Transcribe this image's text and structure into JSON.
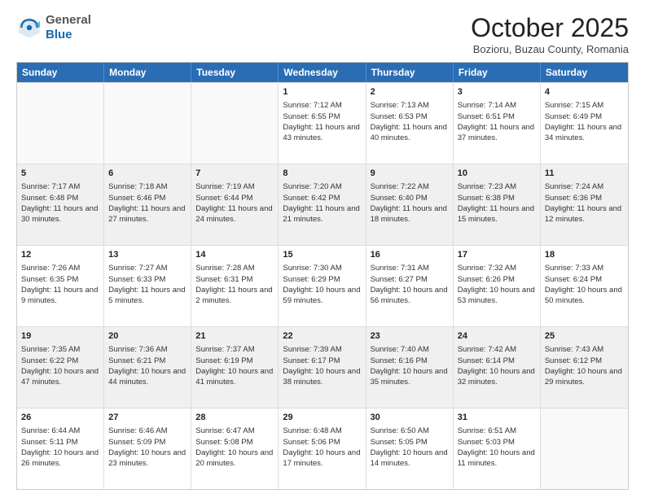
{
  "header": {
    "logo": {
      "general": "General",
      "blue": "Blue"
    },
    "title": "October 2025",
    "subtitle": "Bozioru, Buzau County, Romania"
  },
  "calendar": {
    "days_of_week": [
      "Sunday",
      "Monday",
      "Tuesday",
      "Wednesday",
      "Thursday",
      "Friday",
      "Saturday"
    ],
    "rows": [
      [
        {
          "day": "",
          "empty": true
        },
        {
          "day": "",
          "empty": true
        },
        {
          "day": "",
          "empty": true
        },
        {
          "day": "1",
          "sunrise": "7:12 AM",
          "sunset": "6:55 PM",
          "daylight": "11 hours and 43 minutes."
        },
        {
          "day": "2",
          "sunrise": "7:13 AM",
          "sunset": "6:53 PM",
          "daylight": "11 hours and 40 minutes."
        },
        {
          "day": "3",
          "sunrise": "7:14 AM",
          "sunset": "6:51 PM",
          "daylight": "11 hours and 37 minutes."
        },
        {
          "day": "4",
          "sunrise": "7:15 AM",
          "sunset": "6:49 PM",
          "daylight": "11 hours and 34 minutes."
        }
      ],
      [
        {
          "day": "5",
          "sunrise": "7:17 AM",
          "sunset": "6:48 PM",
          "daylight": "11 hours and 30 minutes."
        },
        {
          "day": "6",
          "sunrise": "7:18 AM",
          "sunset": "6:46 PM",
          "daylight": "11 hours and 27 minutes."
        },
        {
          "day": "7",
          "sunrise": "7:19 AM",
          "sunset": "6:44 PM",
          "daylight": "11 hours and 24 minutes."
        },
        {
          "day": "8",
          "sunrise": "7:20 AM",
          "sunset": "6:42 PM",
          "daylight": "11 hours and 21 minutes."
        },
        {
          "day": "9",
          "sunrise": "7:22 AM",
          "sunset": "6:40 PM",
          "daylight": "11 hours and 18 minutes."
        },
        {
          "day": "10",
          "sunrise": "7:23 AM",
          "sunset": "6:38 PM",
          "daylight": "11 hours and 15 minutes."
        },
        {
          "day": "11",
          "sunrise": "7:24 AM",
          "sunset": "6:36 PM",
          "daylight": "11 hours and 12 minutes."
        }
      ],
      [
        {
          "day": "12",
          "sunrise": "7:26 AM",
          "sunset": "6:35 PM",
          "daylight": "11 hours and 9 minutes."
        },
        {
          "day": "13",
          "sunrise": "7:27 AM",
          "sunset": "6:33 PM",
          "daylight": "11 hours and 5 minutes."
        },
        {
          "day": "14",
          "sunrise": "7:28 AM",
          "sunset": "6:31 PM",
          "daylight": "11 hours and 2 minutes."
        },
        {
          "day": "15",
          "sunrise": "7:30 AM",
          "sunset": "6:29 PM",
          "daylight": "10 hours and 59 minutes."
        },
        {
          "day": "16",
          "sunrise": "7:31 AM",
          "sunset": "6:27 PM",
          "daylight": "10 hours and 56 minutes."
        },
        {
          "day": "17",
          "sunrise": "7:32 AM",
          "sunset": "6:26 PM",
          "daylight": "10 hours and 53 minutes."
        },
        {
          "day": "18",
          "sunrise": "7:33 AM",
          "sunset": "6:24 PM",
          "daylight": "10 hours and 50 minutes."
        }
      ],
      [
        {
          "day": "19",
          "sunrise": "7:35 AM",
          "sunset": "6:22 PM",
          "daylight": "10 hours and 47 minutes."
        },
        {
          "day": "20",
          "sunrise": "7:36 AM",
          "sunset": "6:21 PM",
          "daylight": "10 hours and 44 minutes."
        },
        {
          "day": "21",
          "sunrise": "7:37 AM",
          "sunset": "6:19 PM",
          "daylight": "10 hours and 41 minutes."
        },
        {
          "day": "22",
          "sunrise": "7:39 AM",
          "sunset": "6:17 PM",
          "daylight": "10 hours and 38 minutes."
        },
        {
          "day": "23",
          "sunrise": "7:40 AM",
          "sunset": "6:16 PM",
          "daylight": "10 hours and 35 minutes."
        },
        {
          "day": "24",
          "sunrise": "7:42 AM",
          "sunset": "6:14 PM",
          "daylight": "10 hours and 32 minutes."
        },
        {
          "day": "25",
          "sunrise": "7:43 AM",
          "sunset": "6:12 PM",
          "daylight": "10 hours and 29 minutes."
        }
      ],
      [
        {
          "day": "26",
          "sunrise": "6:44 AM",
          "sunset": "5:11 PM",
          "daylight": "10 hours and 26 minutes."
        },
        {
          "day": "27",
          "sunrise": "6:46 AM",
          "sunset": "5:09 PM",
          "daylight": "10 hours and 23 minutes."
        },
        {
          "day": "28",
          "sunrise": "6:47 AM",
          "sunset": "5:08 PM",
          "daylight": "10 hours and 20 minutes."
        },
        {
          "day": "29",
          "sunrise": "6:48 AM",
          "sunset": "5:06 PM",
          "daylight": "10 hours and 17 minutes."
        },
        {
          "day": "30",
          "sunrise": "6:50 AM",
          "sunset": "5:05 PM",
          "daylight": "10 hours and 14 minutes."
        },
        {
          "day": "31",
          "sunrise": "6:51 AM",
          "sunset": "5:03 PM",
          "daylight": "10 hours and 11 minutes."
        },
        {
          "day": "",
          "empty": true
        }
      ]
    ]
  }
}
